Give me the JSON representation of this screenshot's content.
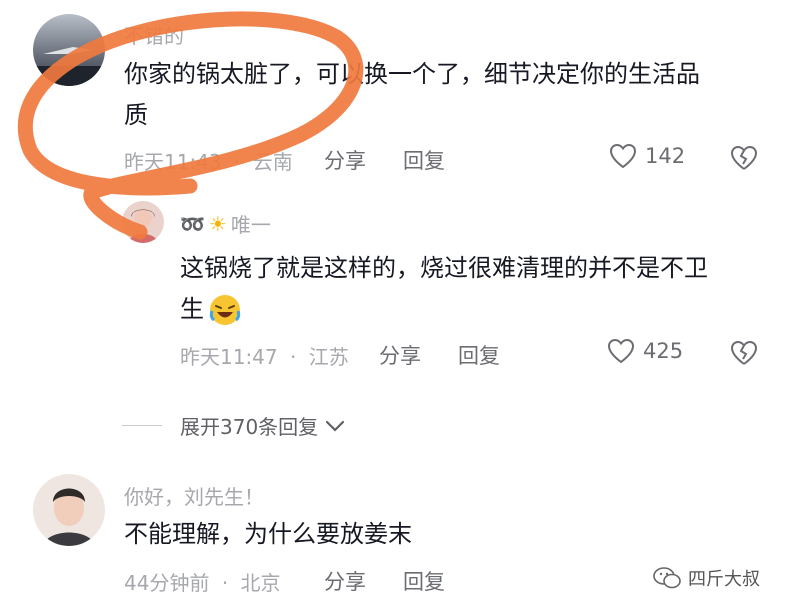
{
  "comments": [
    {
      "username": "不错的",
      "text_line1": "你家的锅太脏了，可以换一个了，细节决定你的生活品",
      "text_line2": "质",
      "time": "昨天11:43",
      "location": "云南",
      "share": "分享",
      "reply": "回复",
      "likes": "142"
    },
    {
      "username": "唯一",
      "text_line1": "这锅烧了就是这样的，烧过很难清理的并不是不卫",
      "text_line2": "生",
      "time": "昨天11:47",
      "location": "江苏",
      "share": "分享",
      "reply": "回复",
      "likes": "425"
    },
    {
      "username": "你好，刘先生！",
      "text_line1": "不能理解，为什么要放姜末",
      "time": "44分钟前",
      "location": "北京",
      "share": "分享",
      "reply": "回复"
    }
  ],
  "expand_label": "展开370条回复",
  "separator": "·",
  "watermark": "四斤大叔",
  "colors": {
    "annotation": "#f07a3e",
    "text": "#161823",
    "meta": "#a6a8ad"
  }
}
